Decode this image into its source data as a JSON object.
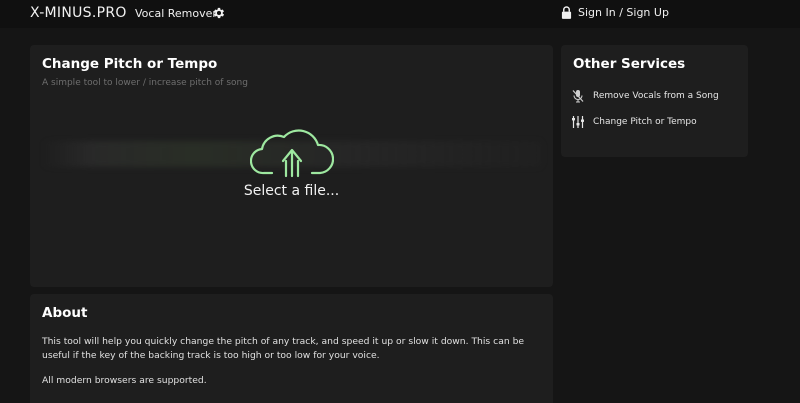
{
  "header": {
    "logo": "X-MINUS.PRO",
    "nav_vocal_remover": "Vocal Remover",
    "settings_icon": "gear-icon",
    "sign_in": "Sign In / Sign Up",
    "sign_in_icon": "lock-icon"
  },
  "main": {
    "title": "Change Pitch or Tempo",
    "subtitle": "A simple tool to lower / increase pitch of song",
    "upload_icon": "cloud-upload-icon",
    "upload_label": "Select a file..."
  },
  "about": {
    "title": "About",
    "paragraph1": "This tool will help you quickly change the pitch of any track, and speed it up or slow it down. This can be useful if the key of the backing track is too high or too low for your voice.",
    "paragraph2": "All modern browsers are supported."
  },
  "sidebar": {
    "title": "Other Services",
    "items": [
      {
        "label": "Remove Vocals from a Song",
        "icon": "muted-microphone-icon"
      },
      {
        "label": "Change Pitch or Tempo",
        "icon": "sliders-icon"
      }
    ]
  },
  "colors": {
    "background": "#151515",
    "card": "#1e1e1e",
    "accent_green": "#9ee8a0"
  }
}
